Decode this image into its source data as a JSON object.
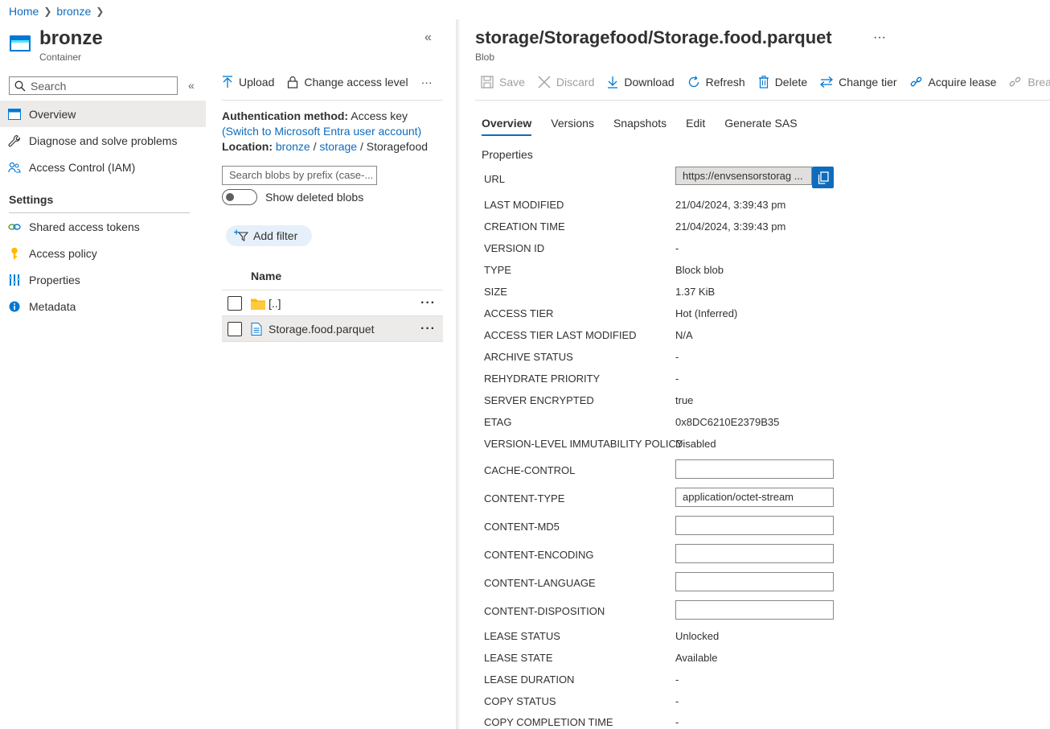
{
  "breadcrumb": {
    "home": "Home",
    "current": "bronze"
  },
  "blade": {
    "title": "bronze",
    "subtitle": "Container"
  },
  "sidebar": {
    "search_placeholder": "Search",
    "items": [
      {
        "label": "Overview",
        "icon": "overview-icon"
      },
      {
        "label": "Diagnose and solve problems",
        "icon": "wrench-icon"
      },
      {
        "label": "Access Control (IAM)",
        "icon": "people-icon"
      }
    ],
    "section": "Settings",
    "settings_items": [
      {
        "label": "Shared access tokens",
        "icon": "link-icon"
      },
      {
        "label": "Access policy",
        "icon": "key-icon"
      },
      {
        "label": "Properties",
        "icon": "properties-icon"
      },
      {
        "label": "Metadata",
        "icon": "info-icon"
      }
    ]
  },
  "middle": {
    "toolbar": {
      "upload": "Upload",
      "change_access": "Change access level",
      "more": "···"
    },
    "auth_label": "Authentication method:",
    "auth_value": "Access key",
    "auth_link": "(Switch to Microsoft Entra user account)",
    "location_label": "Location:",
    "location_parts": [
      "bronze",
      "storage",
      "Storagefood"
    ],
    "search_placeholder": "Search blobs by prefix (case-...",
    "show_deleted": "Show deleted blobs",
    "add_filter": "Add filter",
    "name_header": "Name",
    "rows": [
      {
        "name": "[..]",
        "type": "folder"
      },
      {
        "name": "Storage.food.parquet",
        "type": "file"
      }
    ]
  },
  "right": {
    "title": "storage/Storagefood/Storage.food.parquet",
    "subtitle": "Blob",
    "toolbar": {
      "save": "Save",
      "discard": "Discard",
      "download": "Download",
      "refresh": "Refresh",
      "delete": "Delete",
      "change_tier": "Change tier",
      "acquire_lease": "Acquire lease",
      "break_lease": "Break lea"
    },
    "tabs": [
      "Overview",
      "Versions",
      "Snapshots",
      "Edit",
      "Generate SAS"
    ],
    "properties_heading": "Properties",
    "url_label": "URL",
    "url_value": "https://envsensorstorag ...",
    "props_top": [
      {
        "label": "LAST MODIFIED",
        "value": "21/04/2024, 3:39:43 pm"
      },
      {
        "label": "CREATION TIME",
        "value": "21/04/2024, 3:39:43 pm"
      },
      {
        "label": "VERSION ID",
        "value": "-"
      },
      {
        "label": "TYPE",
        "value": "Block blob"
      },
      {
        "label": "SIZE",
        "value": "1.37 KiB"
      },
      {
        "label": "ACCESS TIER",
        "value": "Hot (Inferred)"
      },
      {
        "label": "ACCESS TIER LAST MODIFIED",
        "value": "N/A"
      },
      {
        "label": "ARCHIVE STATUS",
        "value": "-"
      },
      {
        "label": "REHYDRATE PRIORITY",
        "value": "-"
      },
      {
        "label": "SERVER ENCRYPTED",
        "value": "true"
      },
      {
        "label": "ETAG",
        "value": "0x8DC6210E2379B35"
      },
      {
        "label": "VERSION-LEVEL IMMUTABILITY POLICY",
        "value": "Disabled"
      }
    ],
    "editable": [
      {
        "label": "CACHE-CONTROL",
        "value": ""
      },
      {
        "label": "CONTENT-TYPE",
        "value": "application/octet-stream"
      },
      {
        "label": "CONTENT-MD5",
        "value": ""
      },
      {
        "label": "CONTENT-ENCODING",
        "value": ""
      },
      {
        "label": "CONTENT-LANGUAGE",
        "value": ""
      },
      {
        "label": "CONTENT-DISPOSITION",
        "value": ""
      }
    ],
    "props_bottom": [
      {
        "label": "LEASE STATUS",
        "value": "Unlocked"
      },
      {
        "label": "LEASE STATE",
        "value": "Available"
      },
      {
        "label": "LEASE DURATION",
        "value": "-"
      },
      {
        "label": "COPY STATUS",
        "value": "-"
      },
      {
        "label": "COPY COMPLETION TIME",
        "value": "-"
      }
    ]
  },
  "colors": {
    "accent": "#0f6cbd",
    "folder": "#ffb900",
    "selected_row": "#edebe9"
  }
}
